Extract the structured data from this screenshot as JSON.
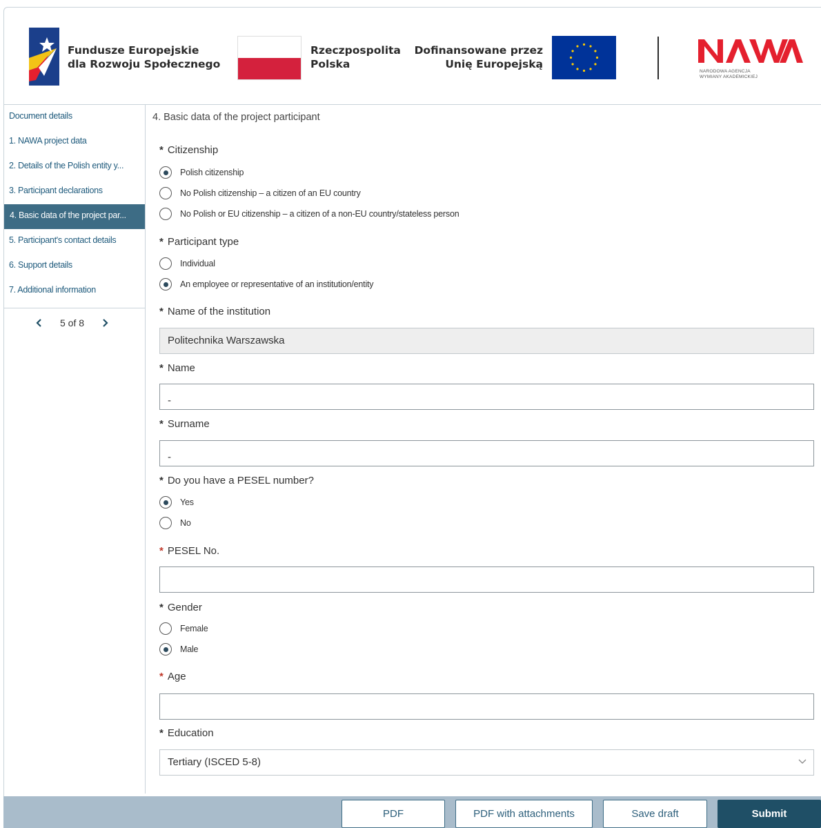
{
  "header": {
    "fe_line1": "Fundusze Europejskie",
    "fe_line2": "dla Rozwoju Społecznego",
    "rp_line1": "Rzeczpospolita",
    "rp_line2": "Polska",
    "eu_line1": "Dofinansowane przez",
    "eu_line2": "Unię Europejską",
    "nawa_logo": "NAWA",
    "nawa_sub1": "NARODOWA AGENCJA",
    "nawa_sub2": "WYMIANY AKADEMICKIEJ",
    "colors": {
      "pl_red": "#d4213d",
      "eu_blue": "#003399",
      "nawa_red": "#e4202e"
    }
  },
  "sidebar": {
    "items": [
      {
        "label": "Document details"
      },
      {
        "label": "1. NAWA project data"
      },
      {
        "label": "2. Details of the Polish entity y..."
      },
      {
        "label": "3. Participant declarations"
      },
      {
        "label": "4. Basic data of the project par...",
        "active": true
      },
      {
        "label": "5. Participant's contact details"
      },
      {
        "label": "6. Support details"
      },
      {
        "label": "7. Additional information"
      }
    ],
    "pager": {
      "text": "5 of 8"
    }
  },
  "form": {
    "section_title": "4. Basic data of the project participant",
    "citizenship": {
      "label": "Citizenship",
      "options": [
        "Polish citizenship",
        "No Polish citizenship – a citizen of an EU country",
        "No Polish or EU citizenship – a citizen of a non-EU country/stateless person"
      ],
      "selected": 0
    },
    "participant_type": {
      "label": "Participant type",
      "options": [
        "Individual",
        "An employee or representative of an institution/entity"
      ],
      "selected": 1
    },
    "institution": {
      "label": "Name of the institution",
      "value": "Politechnika Warszawska"
    },
    "name": {
      "label": "Name",
      "value": "-"
    },
    "surname": {
      "label": "Surname",
      "value": "-"
    },
    "pesel_question": {
      "label": "Do you have a PESEL number?",
      "options": [
        "Yes",
        "No"
      ],
      "selected": 0
    },
    "pesel_no": {
      "label": "PESEL No.",
      "value": ""
    },
    "gender": {
      "label": "Gender",
      "options": [
        "Female",
        "Male"
      ],
      "selected": 1
    },
    "age": {
      "label": "Age",
      "value": ""
    },
    "education": {
      "label": "Education",
      "value": "Tertiary (ISCED 5-8)"
    }
  },
  "footer": {
    "pdf": "PDF",
    "pdf_attachments": "PDF with attachments",
    "save_draft": "Save draft",
    "submit": "Submit"
  }
}
